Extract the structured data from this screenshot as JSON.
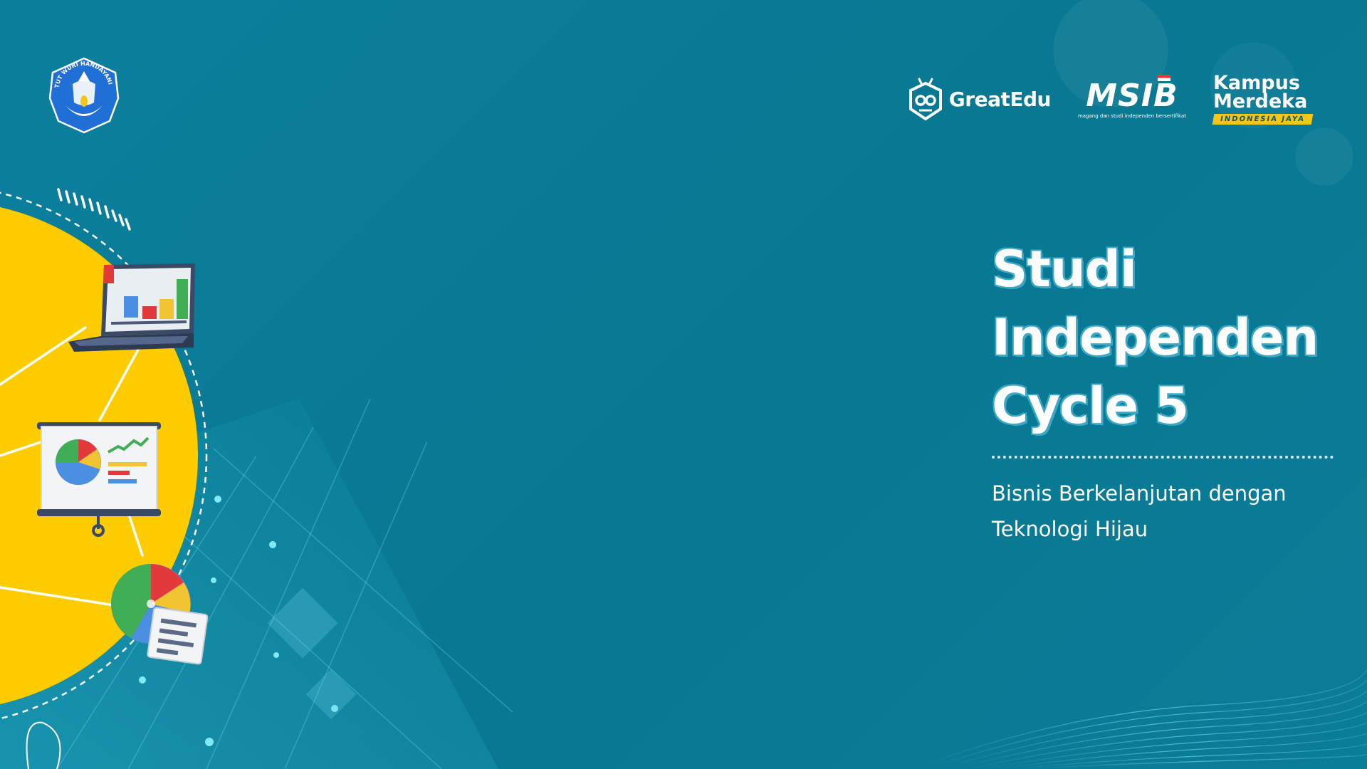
{
  "header": {
    "logo_tutwuri_text": "TUT WURI HANDAYANI",
    "greatedu": "GreatEdu",
    "msib": "MSIB",
    "msib_sub": "magang dan studi independen bersertifikat",
    "kampus_line1": "Kampus",
    "kampus_line2": "Merdeka",
    "kampus_badge": "INDONESIA JAYA"
  },
  "title": {
    "line1": "Studi",
    "line2": "Independen",
    "line3": "Cycle 5"
  },
  "subtitle": {
    "line1": "Bisnis Berkelanjutan dengan",
    "line2": "Teknologi Hijau"
  },
  "colors": {
    "background": "#087a96",
    "accent_yellow": "#ffcc00",
    "title_outline": "#3aa8c6",
    "text": "#ffffff"
  },
  "icons": [
    "tutwuri-logo-icon",
    "greatedu-logo-icon",
    "laptop-chart-icon",
    "presentation-board-icon",
    "pie-chart-document-icon"
  ]
}
